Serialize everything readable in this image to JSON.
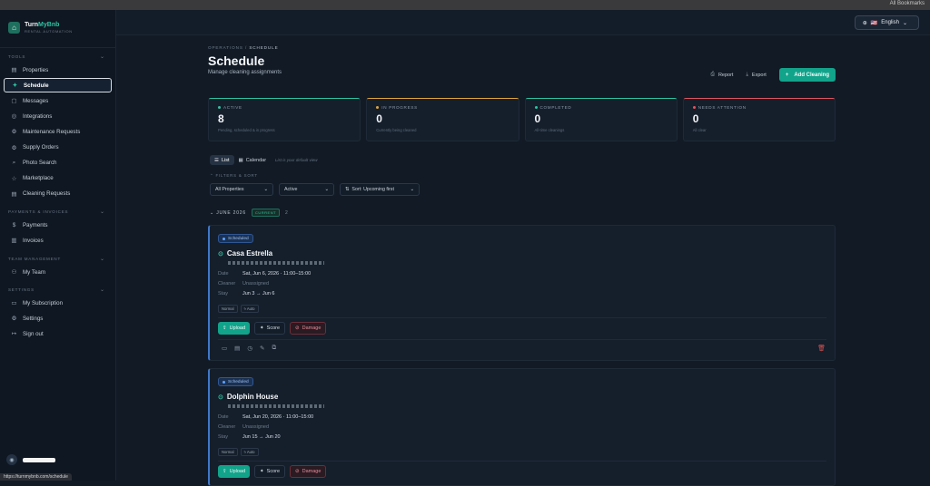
{
  "browser": {
    "bookmarks": "All Bookmarks"
  },
  "brand": {
    "name_a": "Turn",
    "name_b": "MyBnb",
    "tagline": "RENTAL AUTOMATION"
  },
  "sidebar": {
    "sections": [
      {
        "title": "TOOLS",
        "items": [
          {
            "label": "Properties",
            "icon": "building-icon",
            "glyph": "▤"
          },
          {
            "label": "Schedule",
            "icon": "sparkle-icon",
            "glyph": "✦",
            "active": true
          },
          {
            "label": "Messages",
            "icon": "chat-icon",
            "glyph": "▢"
          },
          {
            "label": "Integrations",
            "icon": "globe-icon",
            "glyph": "◎"
          },
          {
            "label": "Maintenance Requests",
            "icon": "wrench-icon",
            "glyph": "⚙"
          },
          {
            "label": "Supply Orders",
            "icon": "package-icon",
            "glyph": "⚙"
          },
          {
            "label": "Photo Search",
            "icon": "search-icon",
            "glyph": "⌕"
          },
          {
            "label": "Marketplace",
            "icon": "star-icon",
            "glyph": "☆"
          },
          {
            "label": "Cleaning Requests",
            "icon": "clipboard-icon",
            "glyph": "▤"
          }
        ]
      },
      {
        "title": "PAYMENTS & INVOICES",
        "items": [
          {
            "label": "Payments",
            "icon": "dollar-icon",
            "glyph": "$"
          },
          {
            "label": "Invoices",
            "icon": "invoice-icon",
            "glyph": "▥"
          }
        ]
      },
      {
        "title": "TEAM MANAGEMENT",
        "items": [
          {
            "label": "My Team",
            "icon": "team-icon",
            "glyph": "⚇"
          }
        ]
      },
      {
        "title": "SETTINGS",
        "items": [
          {
            "label": "My Subscription",
            "icon": "card-icon",
            "glyph": "▭"
          },
          {
            "label": "Settings",
            "icon": "gear-icon",
            "glyph": "⚙"
          },
          {
            "label": "Sign out",
            "icon": "signout-icon",
            "glyph": "↦"
          }
        ]
      }
    ]
  },
  "status_url": "https://turnmybnb.com/schedule",
  "lang": {
    "flag": "🇺🇸",
    "label": "English"
  },
  "header": {
    "crumb_a": "OPERATIONS",
    "crumb_b": "SCHEDULE",
    "title": "Schedule",
    "subtitle": "Manage cleaning assignments",
    "report": "Report",
    "export": "Export",
    "add": "Add Cleaning"
  },
  "stats": [
    {
      "label": "ACTIVE",
      "value": "8",
      "desc": "Pending, scheduled & in progress",
      "color": "#2fc3a2"
    },
    {
      "label": "IN PROGRESS",
      "value": "0",
      "desc": "Currently being cleaned",
      "color": "#e0a43a"
    },
    {
      "label": "COMPLETED",
      "value": "0",
      "desc": "All-time cleanings",
      "color": "#2fc3a2"
    },
    {
      "label": "NEEDS ATTENTION",
      "value": "0",
      "desc": "All clear",
      "color": "#e05561"
    }
  ],
  "views": {
    "list": "List",
    "calendar": "Calendar",
    "hint": "List is your default view"
  },
  "filters": {
    "label": "FILTERS & SORT",
    "property": "All Properties",
    "status": "Active",
    "sort": "Sort: Upcoming first"
  },
  "month": {
    "label": "JUNE 2026",
    "badge": "CURRENT",
    "count": "2"
  },
  "cards": [
    {
      "status": "Scheduled",
      "name": "Casa Estrella",
      "date": "Sat, Jun 6, 2026 · 11:00–15:00",
      "cleaner": "Unassigned",
      "stay": "Jun 3 → Jun 6",
      "tag1": "Normal",
      "tag2": "Auto"
    },
    {
      "status": "Scheduled",
      "name": "Dolphin House",
      "date": "Sat, Jun 20, 2026 · 11:00–15:00",
      "cleaner": "Unassigned",
      "stay": "Jun 15 → Jun 20",
      "tag1": "Normal",
      "tag2": "Auto"
    }
  ],
  "card_labels": {
    "date": "Date",
    "cleaner": "Cleaner",
    "stay": "Stay",
    "upload": "Upload",
    "score": "Score",
    "damage": "Damage"
  }
}
